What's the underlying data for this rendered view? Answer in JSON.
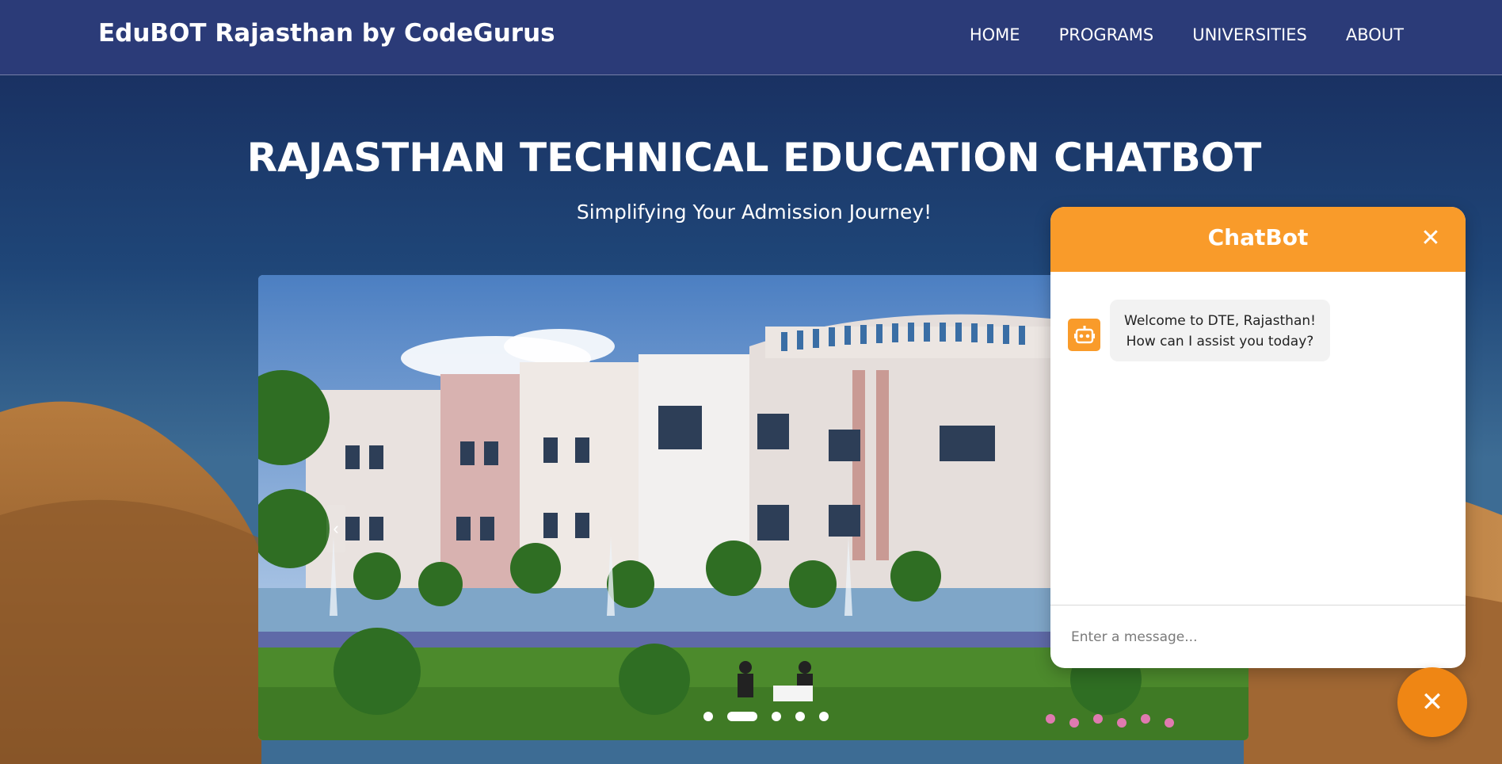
{
  "header": {
    "brand": "EduBOT Rajasthan by CodeGurus",
    "nav": [
      {
        "label": "HOME"
      },
      {
        "label": "PROGRAMS"
      },
      {
        "label": "UNIVERSITIES"
      },
      {
        "label": "ABOUT"
      }
    ]
  },
  "hero": {
    "title": "RAJASTHAN TECHNICAL EDUCATION CHATBOT",
    "subtitle": "Simplifying Your Admission Journey!"
  },
  "carousel": {
    "prev_icon": "chevron-left-icon",
    "prev_glyph": "‹",
    "slide_count": 5,
    "active_slide": 2
  },
  "chatbot": {
    "title": "ChatBot",
    "close_glyph": "✕",
    "messages": [
      {
        "from": "bot",
        "line1": "Welcome to DTE, Rajasthan!",
        "line2": "How can I assist you today?"
      }
    ],
    "input_placeholder": "Enter a message...",
    "toggle_glyph": "✕"
  },
  "colors": {
    "header_bg": "#2b3b78",
    "accent": "#f99b2a",
    "fab": "#ef8614"
  }
}
